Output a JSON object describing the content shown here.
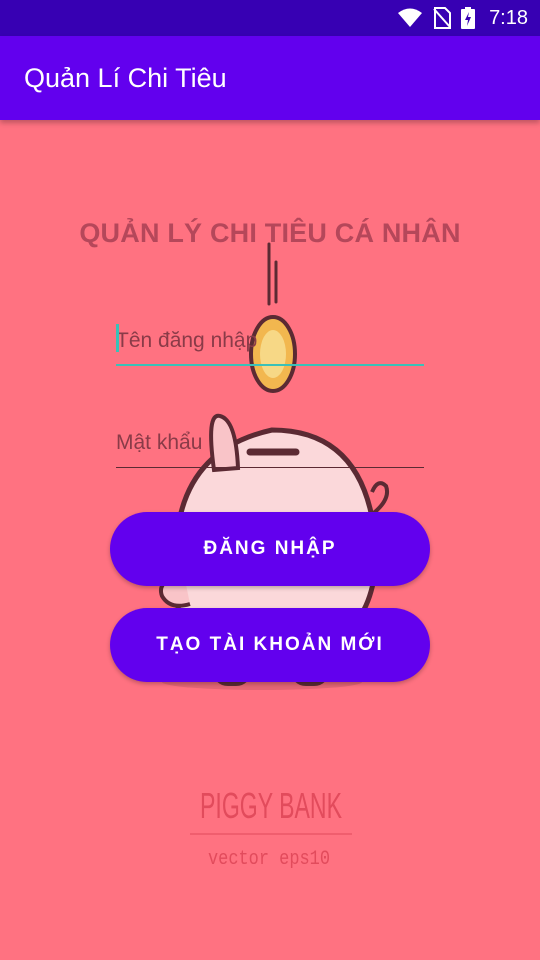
{
  "status_bar": {
    "time": "7:18",
    "icons": [
      "wifi-icon",
      "no-sim-icon",
      "battery-charging-icon"
    ]
  },
  "app_bar": {
    "title": "Quản Lí Chi Tiêu"
  },
  "background": {
    "brand": "PIGGY BANK",
    "tagline": "vector eps10"
  },
  "login": {
    "heading": "QUẢN LÝ CHI TIÊU CÁ NHÂN",
    "username_placeholder": "Tên đăng nhập",
    "password_placeholder": "Mật khẩu",
    "login_button": "ĐĂNG NHẬP",
    "signup_button": "TẠO TÀI KHOẢN MỚI"
  },
  "colors": {
    "background": "#ff7281",
    "app_bar": "#6200ee",
    "status_bar": "#3700b3",
    "button": "#6200ee",
    "heading": "#b5475a",
    "focus_accent": "#3ac1b8"
  }
}
